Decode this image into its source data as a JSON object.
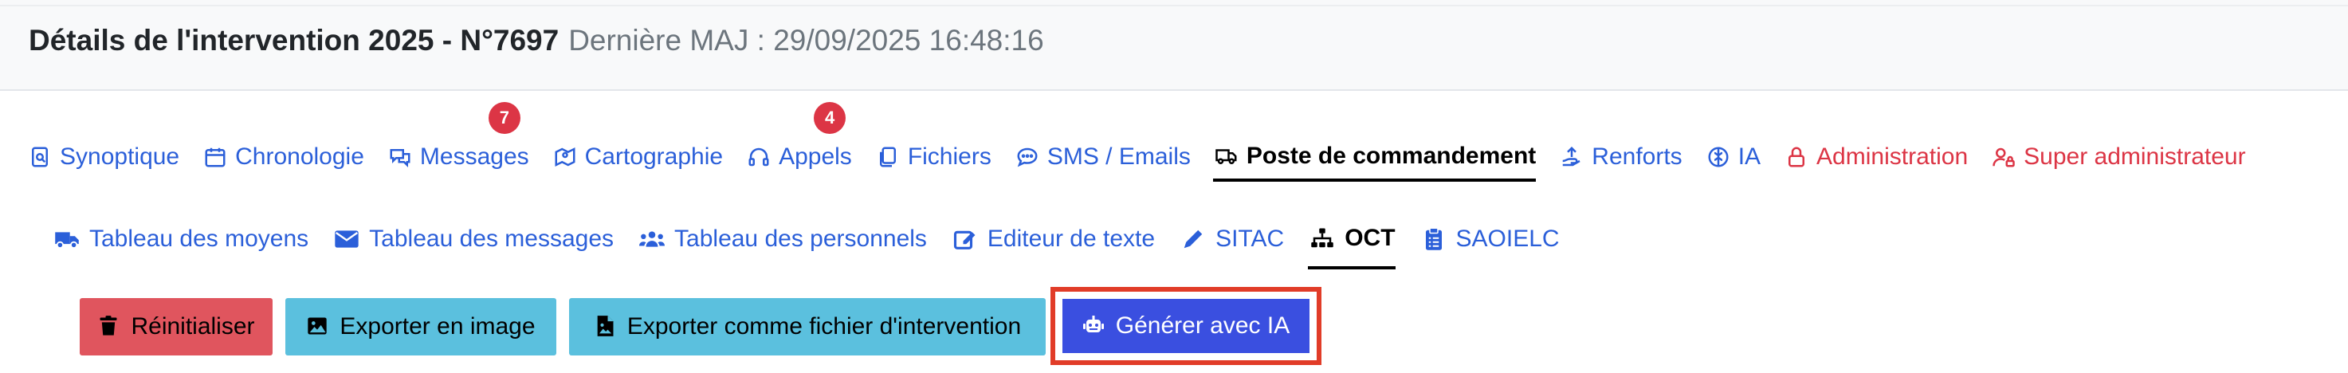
{
  "header": {
    "title": "Détails de l'intervention 2025 - N°7697",
    "last_update": "Dernière MAJ : 29/09/2025 16:48:16"
  },
  "main_tabs": [
    {
      "label": "Synoptique",
      "icon": "synoptic-icon"
    },
    {
      "label": "Chronologie",
      "icon": "calendar-icon"
    },
    {
      "label": "Messages",
      "icon": "chat-icon",
      "badge": "7"
    },
    {
      "label": "Cartographie",
      "icon": "map-icon"
    },
    {
      "label": "Appels",
      "icon": "headset-icon",
      "badge": "4"
    },
    {
      "label": "Fichiers",
      "icon": "files-icon"
    },
    {
      "label": "SMS / Emails",
      "icon": "sms-icon"
    },
    {
      "label": "Poste de commandement",
      "icon": "truck-icon",
      "active": true
    },
    {
      "label": "Renforts",
      "icon": "reinforcement-icon"
    },
    {
      "label": "IA",
      "icon": "brain-icon"
    },
    {
      "label": "Administration",
      "icon": "lock-icon"
    },
    {
      "label": "Super administrateur",
      "icon": "user-lock-icon"
    }
  ],
  "sub_tabs": [
    {
      "label": "Tableau des moyens",
      "icon": "truck-solid-icon"
    },
    {
      "label": "Tableau des messages",
      "icon": "envelope-icon"
    },
    {
      "label": "Tableau des personnels",
      "icon": "users-icon"
    },
    {
      "label": "Editeur de texte",
      "icon": "edit-icon"
    },
    {
      "label": "SITAC",
      "icon": "pen-icon"
    },
    {
      "label": "OCT",
      "icon": "sitemap-icon",
      "active": true
    },
    {
      "label": "SAOIELC",
      "icon": "clipboard-icon"
    }
  ],
  "toolbar": {
    "reset_label": "Réinitialiser",
    "export_image_label": "Exporter en image",
    "export_file_label": "Exporter comme fichier d'intervention",
    "generate_ai_label": "Générer avec IA"
  },
  "colors": {
    "link": "#2b5fd9",
    "danger": "#dc3545",
    "reset_button": "#e0555e",
    "info_button": "#5bc0de",
    "ai_button": "#3a4fe0",
    "highlight": "#e13c28"
  }
}
